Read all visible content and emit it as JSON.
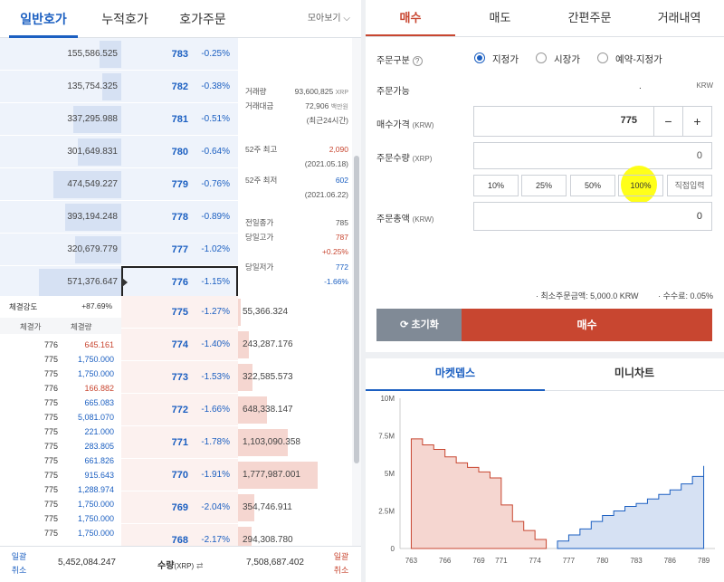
{
  "left_tabs": {
    "general": "일반호가",
    "cumulative": "누적호가",
    "order": "호가주문",
    "more": "모아보기"
  },
  "asks": [
    {
      "vol": "155,586.525",
      "price": "783",
      "pct": "-0.25%",
      "bar": 0.25
    },
    {
      "vol": "135,754.325",
      "price": "782",
      "pct": "-0.38%",
      "bar": 0.22
    },
    {
      "vol": "337,295.988",
      "price": "781",
      "pct": "-0.51%",
      "bar": 0.55
    },
    {
      "vol": "301,649.831",
      "price": "780",
      "pct": "-0.64%",
      "bar": 0.5
    },
    {
      "vol": "474,549.227",
      "price": "779",
      "pct": "-0.76%",
      "bar": 0.78
    },
    {
      "vol": "393,194.248",
      "price": "778",
      "pct": "-0.89%",
      "bar": 0.65
    },
    {
      "vol": "320,679.779",
      "price": "777",
      "pct": "-1.02%",
      "bar": 0.53
    },
    {
      "vol": "571,376.647",
      "price": "776",
      "pct": "-1.15%",
      "bar": 0.95
    }
  ],
  "bids": [
    {
      "vol": "55,366.324",
      "price": "775",
      "pct": "-1.27%",
      "bar": 0.03
    },
    {
      "vol": "243,287.176",
      "price": "774",
      "pct": "-1.40%",
      "bar": 0.14
    },
    {
      "vol": "322,585.573",
      "price": "773",
      "pct": "-1.53%",
      "bar": 0.18
    },
    {
      "vol": "648,338.147",
      "price": "772",
      "pct": "-1.66%",
      "bar": 0.36
    },
    {
      "vol": "1,103,090.358",
      "price": "771",
      "pct": "-1.78%",
      "bar": 0.62
    },
    {
      "vol": "1,777,987.001",
      "price": "770",
      "pct": "-1.91%",
      "bar": 1.0
    },
    {
      "vol": "354,746.911",
      "price": "769",
      "pct": "-2.04%",
      "bar": 0.2
    },
    {
      "vol": "294,308.780",
      "price": "768",
      "pct": "-2.17%",
      "bar": 0.17
    }
  ],
  "info": {
    "volume_label": "거래량",
    "volume": "93,600,825",
    "volume_unit": "XRP",
    "amount_label": "거래대금",
    "amount": "72,906",
    "amount_unit": "백만원",
    "amount_note": "(최근24시간)",
    "high52_label": "52주 최고",
    "high52": "2,090",
    "high52_date": "(2021.05.18)",
    "low52_label": "52주 최저",
    "low52": "602",
    "low52_date": "(2021.06.22)",
    "prev_label": "전일종가",
    "prev": "785",
    "dayhigh_label": "당일고가",
    "dayhigh": "787",
    "dayhigh_pct": "+0.25%",
    "daylow_label": "당일저가",
    "daylow": "772",
    "daylow_pct": "-1.66%"
  },
  "trades": {
    "strength_label": "체결강도",
    "strength": "+87.69%",
    "col_price": "체결가",
    "col_qty": "체결량",
    "rows": [
      {
        "p": "776",
        "q": "645.161",
        "c": "red"
      },
      {
        "p": "775",
        "q": "1,750.000",
        "c": "blue"
      },
      {
        "p": "775",
        "q": "1,750.000",
        "c": "blue"
      },
      {
        "p": "776",
        "q": "166.882",
        "c": "red"
      },
      {
        "p": "775",
        "q": "665.083",
        "c": "blue"
      },
      {
        "p": "775",
        "q": "5,081.070",
        "c": "blue"
      },
      {
        "p": "775",
        "q": "221.000",
        "c": "blue"
      },
      {
        "p": "775",
        "q": "283.805",
        "c": "blue"
      },
      {
        "p": "775",
        "q": "661.826",
        "c": "blue"
      },
      {
        "p": "775",
        "q": "915.643",
        "c": "blue"
      },
      {
        "p": "775",
        "q": "1,288.974",
        "c": "blue"
      },
      {
        "p": "775",
        "q": "1,750.000",
        "c": "blue"
      },
      {
        "p": "775",
        "q": "1,750.000",
        "c": "blue"
      },
      {
        "p": "775",
        "q": "1,750.000",
        "c": "blue"
      }
    ]
  },
  "footer": {
    "bulk1": "일괄",
    "cancel1": "취소",
    "ask_total": "5,452,084.247",
    "qty_label": "수량",
    "qty_unit": "(XRP)",
    "bid_total": "7,508,687.402",
    "bulk2": "일괄",
    "cancel2": "취소"
  },
  "order": {
    "tabs": [
      "매수",
      "매도",
      "간편주문",
      "거래내역"
    ],
    "type_label": "주문구분",
    "help": "?",
    "types": [
      "지정가",
      "시장가",
      "예약-지정가"
    ],
    "available_label": "주문가능",
    "available_value": ".",
    "available_unit": "KRW",
    "price_label": "매수가격",
    "price_unit": "(KRW)",
    "price_value": "775",
    "minus": "−",
    "plus": "+",
    "qty_label": "주문수량",
    "qty_unit": "(XRP)",
    "qty_value": "0",
    "pct_buttons": [
      "10%",
      "25%",
      "50%",
      "100%",
      "직접입력"
    ],
    "total_label": "주문총액",
    "total_unit": "(KRW)",
    "total_value": "0",
    "min_note": "· 최소주문금액: 5,000.0 KRW",
    "fee_note": "· 수수료: 0.05%",
    "reset": "초기화",
    "buy": "매수"
  },
  "depth_tabs": [
    "마켓뎁스",
    "미니차트"
  ],
  "colors": {
    "blue": "#1b5fc1",
    "red": "#c84630",
    "highlight": "#ffff00"
  },
  "chart_data": {
    "type": "area",
    "x_tick_labels": [
      "763",
      "766",
      "769",
      "771",
      "774",
      "777",
      "780",
      "783",
      "786",
      "789"
    ],
    "y_tick_labels": [
      "0",
      "2.5M",
      "5M",
      "7.5M",
      "10M"
    ],
    "ylim": [
      0,
      10000000
    ],
    "series": [
      {
        "side": "bid",
        "x": [
          763,
          764,
          765,
          766,
          767,
          768,
          769,
          770,
          771,
          772,
          773,
          774,
          775
        ],
        "y": [
          7300000,
          6900000,
          6600000,
          6100000,
          5700000,
          5400000,
          5100000,
          4700000,
          2900000,
          1800000,
          1200000,
          600000,
          300000
        ]
      },
      {
        "side": "ask",
        "x": [
          776,
          777,
          778,
          779,
          780,
          781,
          782,
          783,
          784,
          785,
          786,
          787,
          788,
          789
        ],
        "y": [
          500000,
          900000,
          1300000,
          1800000,
          2200000,
          2500000,
          2800000,
          3000000,
          3300000,
          3600000,
          3900000,
          4300000,
          4800000,
          5500000
        ]
      }
    ]
  }
}
